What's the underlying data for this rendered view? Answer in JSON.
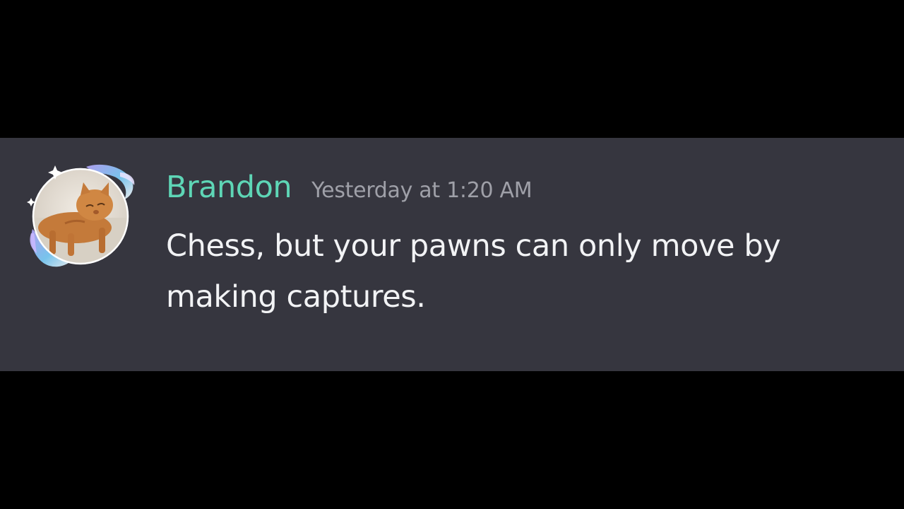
{
  "message": {
    "author": {
      "name": "Brandon",
      "name_color": "#5ed6b6",
      "avatar_icon": "cat-avatar-with-koi-fish-decoration"
    },
    "timestamp": "Yesterday at 1:20 AM",
    "content": "Chess, but your pawns can only move by making captures."
  },
  "colors": {
    "page_background": "#000000",
    "card_background": "#36363f",
    "timestamp_text": "#9fa0a8",
    "body_text": "#f2f3f5"
  }
}
